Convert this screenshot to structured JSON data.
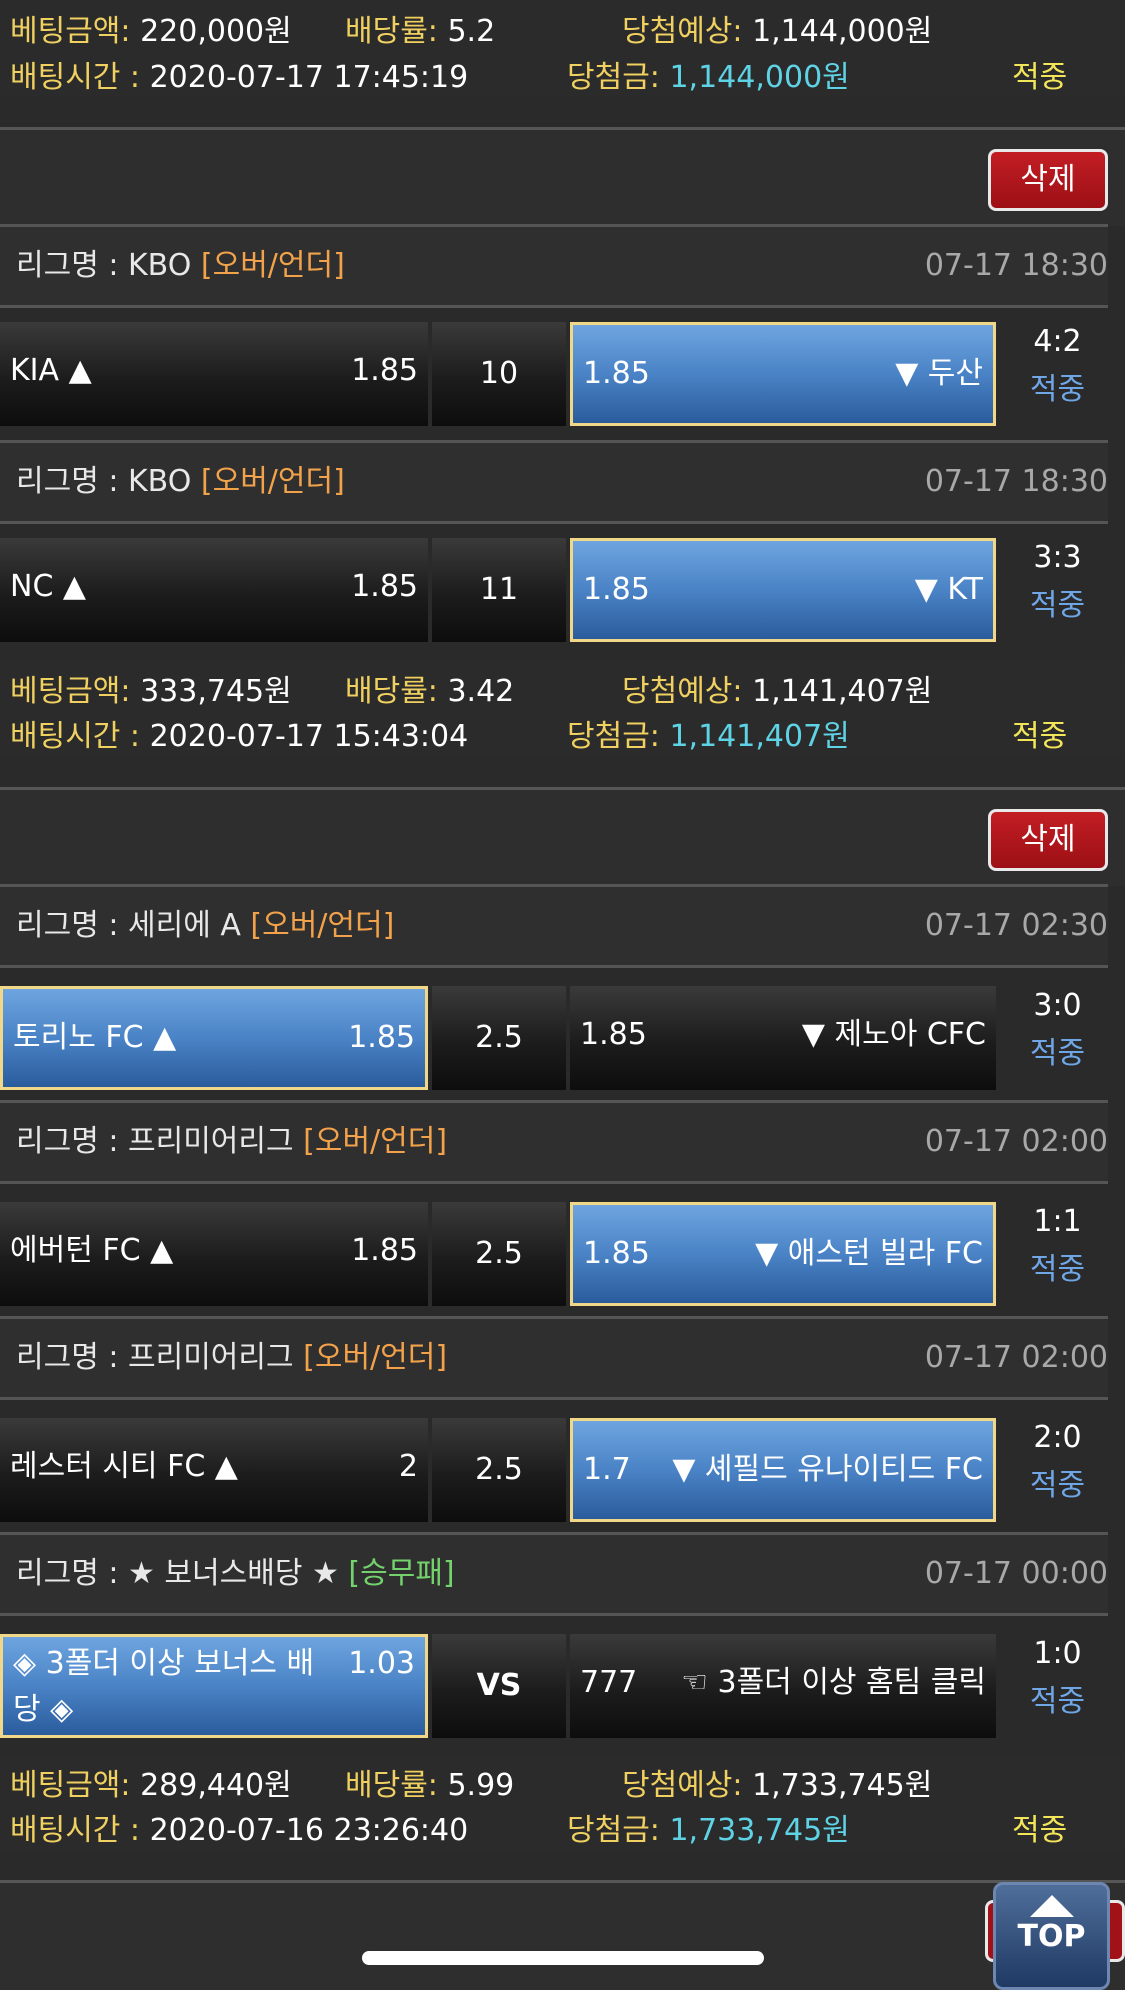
{
  "colors": {
    "selected_odds": "#4a83c6",
    "delete": "#b5171d",
    "hit": "#f3e55a",
    "cyan": "#5fd3e6",
    "result": "#6fa6e6",
    "tag_ou": "#f2a24a",
    "tag_wdl": "#74d26c"
  },
  "labels": {
    "bet_amount": "베팅금액:",
    "odds": "배당률:",
    "expected": "당첨예상:",
    "bet_time": "배팅시간 :",
    "prize": "당첨금:",
    "delete": "삭제",
    "league": "리그명 :",
    "top": "TOP"
  },
  "slips": [
    {
      "bet_amount": "220,000원",
      "odds": "5.2",
      "expected": "1,144,000원",
      "bet_time": "2020-07-17 17:45:19",
      "prize": "1,144,000원",
      "status": "적중"
    },
    {
      "matches": [
        {
          "league": "KBO",
          "tag": "[오버/언더]",
          "date": "07-17 18:30",
          "home": "KIA ▲",
          "home_odds": "1.85",
          "line": "10",
          "away_odds": "1.85",
          "away": "▼ 두산",
          "score": "4:2",
          "result": "적중"
        },
        {
          "league": "KBO",
          "tag": "[오버/언더]",
          "date": "07-17 18:30",
          "home": "NC ▲",
          "home_odds": "1.85",
          "line": "11",
          "away_odds": "1.85",
          "away": "▼ KT",
          "score": "3:3",
          "result": "적중"
        }
      ],
      "bet_amount": "333,745원",
      "odds": "3.42",
      "expected": "1,141,407원",
      "bet_time": "2020-07-17 15:43:04",
      "prize": "1,141,407원",
      "status": "적중"
    },
    {
      "matches": [
        {
          "league": "세리에 A",
          "tag": "[오버/언더]",
          "date": "07-17 02:30",
          "home": "토리노 FC ▲",
          "home_odds": "1.85",
          "line": "2.5",
          "away_odds": "1.85",
          "away": "▼ 제노아 CFC",
          "score": "3:0",
          "result": "적중"
        },
        {
          "league": "프리미어리그",
          "tag": "[오버/언더]",
          "date": "07-17 02:00",
          "home": "에버턴 FC ▲",
          "home_odds": "1.85",
          "line": "2.5",
          "away_odds": "1.85",
          "away": "▼ 애스턴 빌라 FC",
          "score": "1:1",
          "result": "적중"
        },
        {
          "league": "프리미어리그",
          "tag": "[오버/언더]",
          "date": "07-17 02:00",
          "home": "레스터 시티 FC ▲",
          "home_odds": "2",
          "line": "2.5",
          "away_odds": "1.7",
          "away": "▼ 셰필드 유나이티드 FC",
          "score": "2:0",
          "result": "적중"
        },
        {
          "league": "★ 보너스배당 ★",
          "tag": "[승무패]",
          "date": "07-17 00:00",
          "home": "◈ 3폴더 이상 보너스 배당 ◈",
          "home_odds": "1.03",
          "line": "VS",
          "away_odds": "777",
          "away": "☜ 3폴더 이상 홈팀 클릭",
          "score": "1:0",
          "result": "적중"
        }
      ],
      "bet_amount": "289,440원",
      "odds": "5.99",
      "expected": "1,733,745원",
      "bet_time": "2020-07-16 23:26:40",
      "prize": "1,733,745원",
      "status": "적중"
    }
  ]
}
